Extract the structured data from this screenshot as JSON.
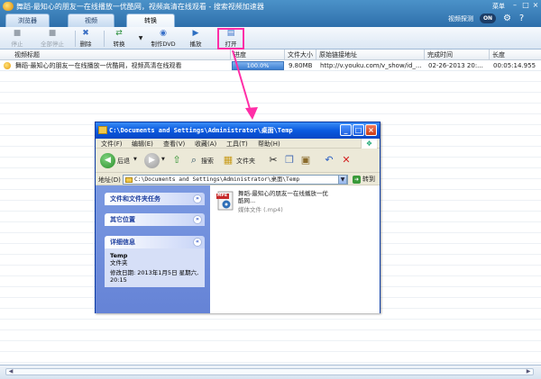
{
  "app": {
    "title": "舞蹈-最知心的朋友一在线播放一优酷网，视频高清在线观看 - 搜索视频加速器",
    "menu": "菜单",
    "stat_label": "视频探测",
    "toggle": "ON",
    "tabs": [
      {
        "label": "浏览器",
        "active": false
      },
      {
        "label": "视频",
        "active": false
      },
      {
        "label": "转换",
        "active": true
      }
    ]
  },
  "toolbar": {
    "items": [
      {
        "label": "停止",
        "icon": "stop-icon",
        "disabled": true
      },
      {
        "label": "全部停止",
        "icon": "stop-all-icon",
        "disabled": true
      },
      {
        "label": "删除",
        "icon": "delete-icon",
        "disabled": false
      },
      {
        "label": "转换",
        "icon": "convert-icon",
        "disabled": false
      },
      {
        "label": "制作DVD",
        "icon": "dvd-icon",
        "disabled": false
      },
      {
        "label": "播放",
        "icon": "play-icon",
        "disabled": false
      },
      {
        "label": "打开",
        "icon": "open-folder-icon",
        "disabled": false
      }
    ]
  },
  "table": {
    "columns": [
      "视频标题",
      "进度",
      "文件大小",
      "原始链接地址",
      "完成时间",
      "长度"
    ],
    "rows": [
      {
        "title": "舞蹈-最知心的朋友一在线播放一优酷网，视频高清在线观看",
        "progress_text": "100.0%",
        "progress": 1.0,
        "size": "9.80MB",
        "url": "http://v.youku.com/v_show/id_...",
        "finished": "02-26-2013 20:...",
        "length": "00:05:14.955"
      }
    ]
  },
  "explorer": {
    "title": "C:\\Documents and Settings\\Administrator\\桌面\\Temp",
    "menu": [
      "文件(F)",
      "编辑(E)",
      "查看(V)",
      "收藏(A)",
      "工具(T)",
      "帮助(H)"
    ],
    "toolbar": {
      "back": "后退",
      "search": "搜索",
      "folders": "文件夹"
    },
    "address_label": "地址(D)",
    "address_value": "C:\\Documents and Settings\\Administrator\\桌面\\Temp",
    "go": "转到",
    "panels": {
      "tasks": "文件和文件夹任务",
      "places": "其它位置",
      "details": "详细信息",
      "detail_name": "Temp",
      "detail_type": "文件夹",
      "detail_modified": "修改日期: 2013年1月5日 星期六, 20:15"
    },
    "file": {
      "badge": "MP4",
      "name": "舞蹈-最知心的朋友一在线播放一优酷网...",
      "type": "媒体文件 (.mp4)"
    }
  },
  "colors": {
    "accent": "#2e6fab",
    "highlight": "#ff2ea7",
    "xp_title": "#0a5ae0"
  }
}
